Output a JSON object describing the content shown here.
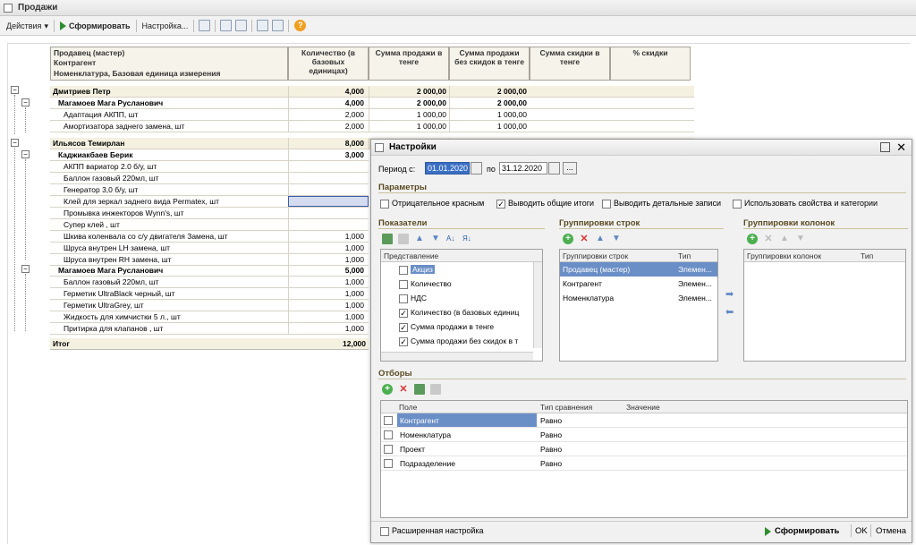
{
  "window": {
    "title": "Продажи"
  },
  "toolbar": {
    "actions": "Действия",
    "generate": "Сформировать",
    "settings": "Настройка...",
    "help": "?"
  },
  "report": {
    "headers": {
      "h1": "Продавец (мастер)",
      "h2": "Контрагент",
      "h3": "Номенклатура, Базовая единица измерения",
      "qty": "Количество (в базовых единицах)",
      "sum": "Сумма продажи в тенге",
      "sum_nd": "Сумма продажи без скидок в тенге",
      "disc": "Сумма скидки в тенге",
      "pct": "% скидки"
    },
    "rows": [
      {
        "name": "Дмитриев Петр",
        "qty": "4,000",
        "s1": "2 000,00",
        "s2": "2 000,00",
        "lvl": 0
      },
      {
        "name": "Магамоев Мага Русланович",
        "qty": "4,000",
        "s1": "2 000,00",
        "s2": "2 000,00",
        "lvl": 1
      },
      {
        "name": "Адаптация АКПП, шт",
        "qty": "2,000",
        "s1": "1 000,00",
        "s2": "1 000,00",
        "lvl": 2
      },
      {
        "name": "Амортизатора заднего замена, шт",
        "qty": "2,000",
        "s1": "1 000,00",
        "s2": "1 000,00",
        "lvl": 2
      },
      {
        "name": "Ильясов Темирлан",
        "qty": "8,000",
        "s1": "",
        "s2": "",
        "lvl": 0
      },
      {
        "name": "Каджиакбаев Берик",
        "qty": "3,000",
        "s1": "",
        "s2": "",
        "lvl": 1
      },
      {
        "name": "АКПП вариатор 2.0 б/у, шт",
        "qty": "",
        "s1": "",
        "s2": "",
        "lvl": 2
      },
      {
        "name": "Баллон газовый 220мл, шт",
        "qty": "",
        "s1": "",
        "s2": "",
        "lvl": 2
      },
      {
        "name": "Генератор 3,0 б/у, шт",
        "qty": "",
        "s1": "",
        "s2": "",
        "lvl": 2
      },
      {
        "name": "Клей для зеркал заднего вида Permatex, шт",
        "qty": "",
        "s1": "",
        "s2": "",
        "lvl": 2
      },
      {
        "name": "Промывка инжекторов Wynn's, шт",
        "qty": "",
        "s1": "",
        "s2": "",
        "lvl": 2
      },
      {
        "name": "Супер клей , шт",
        "qty": "",
        "s1": "",
        "s2": "",
        "lvl": 2
      },
      {
        "name": "Шкива коленвала со с/у двигателя Замена, шт",
        "qty": "1,000",
        "s1": "",
        "s2": "",
        "lvl": 2
      },
      {
        "name": "Шруса внутрен LH замена, шт",
        "qty": "1,000",
        "s1": "",
        "s2": "",
        "lvl": 2
      },
      {
        "name": "Шруса внутрен RH замена, шт",
        "qty": "1,000",
        "s1": "",
        "s2": "",
        "lvl": 2
      },
      {
        "name": "Магамоев Мага Русланович",
        "qty": "5,000",
        "s1": "",
        "s2": "",
        "lvl": 1
      },
      {
        "name": "Баллон газовый 220мл, шт",
        "qty": "1,000",
        "s1": "",
        "s2": "",
        "lvl": 2
      },
      {
        "name": "Герметик UltraBlack черный, шт",
        "qty": "1,000",
        "s1": "",
        "s2": "",
        "lvl": 2
      },
      {
        "name": "Герметик UltraGrey, шт",
        "qty": "1,000",
        "s1": "",
        "s2": "",
        "lvl": 2
      },
      {
        "name": "Жидкость для химчистки 5 л., шт",
        "qty": "1,000",
        "s1": "",
        "s2": "",
        "lvl": 2
      },
      {
        "name": "Притирка для клапанов , шт",
        "qty": "1,000",
        "s1": "",
        "s2": "",
        "lvl": 2
      }
    ],
    "total": {
      "label": "Итог",
      "qty": "12,000"
    }
  },
  "dialog": {
    "title": "Настройки",
    "period_from_label": "Период с:",
    "period_from": "01.01.2020",
    "period_to_label": "по",
    "period_to": "31.12.2020",
    "ellipsis": "...",
    "params_title": "Параметры",
    "params": [
      {
        "label": "Отрицательное красным",
        "checked": false
      },
      {
        "label": "Выводить общие итоги",
        "checked": true
      },
      {
        "label": "Выводить детальные записи",
        "checked": false
      },
      {
        "label": "Использовать свойства и категории",
        "checked": false
      }
    ],
    "indicators_title": "Показатели",
    "indicators_header": "Представление",
    "indicators": [
      {
        "label": "Акциз",
        "checked": false
      },
      {
        "label": "Количество",
        "checked": false
      },
      {
        "label": "НДС",
        "checked": false
      },
      {
        "label": "Количество (в базовых единиц",
        "checked": true
      },
      {
        "label": "Сумма продажи в тенге",
        "checked": true
      },
      {
        "label": "Сумма продажи без скидок в т",
        "checked": true
      }
    ],
    "rowgroups_title": "Группировки строк",
    "rowgroups_headers": {
      "a": "Группировки строк",
      "b": "Тип"
    },
    "rowgroups": [
      {
        "name": "Продавец (мастер)",
        "type": "Элемен..."
      },
      {
        "name": "Контрагент",
        "type": "Элемен..."
      },
      {
        "name": "Номенклатура",
        "type": "Элемен..."
      }
    ],
    "colgroups_title": "Группировки колонок",
    "colgroups_headers": {
      "a": "Группировки колонок",
      "b": "Тип"
    },
    "filters_title": "Отборы",
    "filters_headers": {
      "field": "Поле",
      "cmp": "Тип сравнения",
      "val": "Значение"
    },
    "filters": [
      {
        "field": "Контрагент",
        "cmp": "Равно"
      },
      {
        "field": "Номенклатура",
        "cmp": "Равно"
      },
      {
        "field": "Проект",
        "cmp": "Равно"
      },
      {
        "field": "Подразделение",
        "cmp": "Равно"
      }
    ],
    "extended": "Расширенная настройка",
    "generate": "Сформировать",
    "ok": "OK",
    "cancel": "Отмена"
  }
}
